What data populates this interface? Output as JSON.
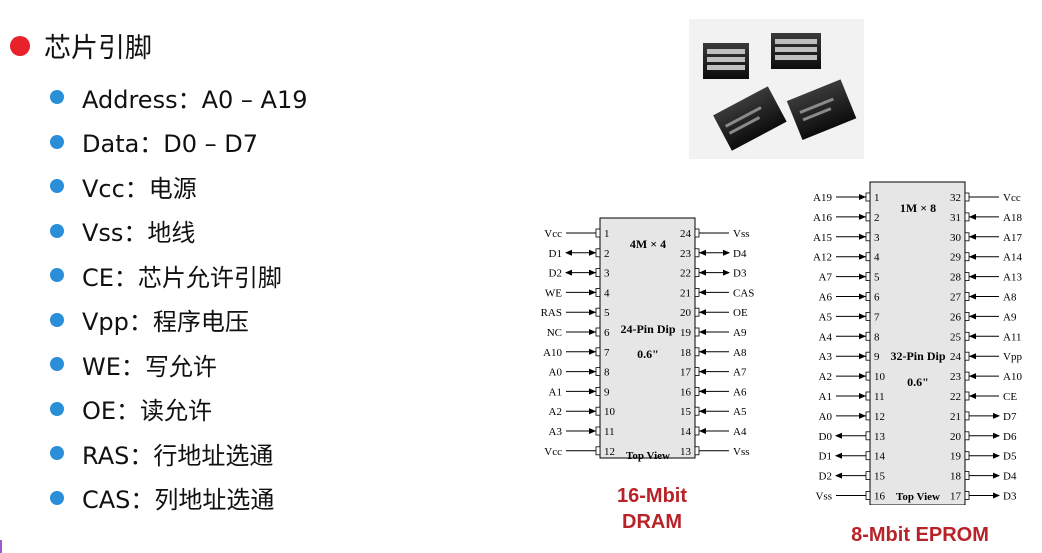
{
  "heading": {
    "title": "芯片引脚",
    "bullet_color": "#e8212b"
  },
  "pins_list": [
    "Address：A0 – A19",
    "Data：D0 – D7",
    "Vcc：电源",
    "Vss：地线",
    "CE：芯片允许引脚",
    "Vpp：程序电压",
    "WE：写允许",
    "OE：读允许",
    "RAS：行地址选通",
    "CAS：列地址选通"
  ],
  "dram": {
    "caption_line1": "16-Mbit",
    "caption_line2": "DRAM",
    "organization": "4M × 4",
    "package": "24-Pin Dip",
    "width": "0.6\"",
    "view": "Top View",
    "left_pins": [
      {
        "num": "1",
        "name": "Vcc",
        "dir": "none"
      },
      {
        "num": "2",
        "name": "D1",
        "dir": "both"
      },
      {
        "num": "3",
        "name": "D2",
        "dir": "both"
      },
      {
        "num": "4",
        "name": "WE",
        "dir": "in"
      },
      {
        "num": "5",
        "name": "RAS",
        "dir": "in"
      },
      {
        "num": "6",
        "name": "NC",
        "dir": "in"
      },
      {
        "num": "7",
        "name": "A10",
        "dir": "in"
      },
      {
        "num": "8",
        "name": "A0",
        "dir": "in"
      },
      {
        "num": "9",
        "name": "A1",
        "dir": "in"
      },
      {
        "num": "10",
        "name": "A2",
        "dir": "in"
      },
      {
        "num": "11",
        "name": "A3",
        "dir": "in"
      },
      {
        "num": "12",
        "name": "Vcc",
        "dir": "none"
      }
    ],
    "right_pins": [
      {
        "num": "24",
        "name": "Vss",
        "dir": "none"
      },
      {
        "num": "23",
        "name": "D4",
        "dir": "both"
      },
      {
        "num": "22",
        "name": "D3",
        "dir": "both"
      },
      {
        "num": "21",
        "name": "CAS",
        "dir": "in"
      },
      {
        "num": "20",
        "name": "OE",
        "dir": "in"
      },
      {
        "num": "19",
        "name": "A9",
        "dir": "in"
      },
      {
        "num": "18",
        "name": "A8",
        "dir": "in"
      },
      {
        "num": "17",
        "name": "A7",
        "dir": "in"
      },
      {
        "num": "16",
        "name": "A6",
        "dir": "in"
      },
      {
        "num": "15",
        "name": "A5",
        "dir": "in"
      },
      {
        "num": "14",
        "name": "A4",
        "dir": "in"
      },
      {
        "num": "13",
        "name": "Vss",
        "dir": "none"
      }
    ]
  },
  "eprom": {
    "caption": "8-Mbit EPROM",
    "organization": "1M × 8",
    "package": "32-Pin Dip",
    "width": "0.6\"",
    "view": "Top View",
    "left_pins": [
      {
        "num": "1",
        "name": "A19",
        "dir": "in"
      },
      {
        "num": "2",
        "name": "A16",
        "dir": "in"
      },
      {
        "num": "3",
        "name": "A15",
        "dir": "in"
      },
      {
        "num": "4",
        "name": "A12",
        "dir": "in"
      },
      {
        "num": "5",
        "name": "A7",
        "dir": "in"
      },
      {
        "num": "6",
        "name": "A6",
        "dir": "in"
      },
      {
        "num": "7",
        "name": "A5",
        "dir": "in"
      },
      {
        "num": "8",
        "name": "A4",
        "dir": "in"
      },
      {
        "num": "9",
        "name": "A3",
        "dir": "in"
      },
      {
        "num": "10",
        "name": "A2",
        "dir": "in"
      },
      {
        "num": "11",
        "name": "A1",
        "dir": "in"
      },
      {
        "num": "12",
        "name": "A0",
        "dir": "in"
      },
      {
        "num": "13",
        "name": "D0",
        "dir": "out"
      },
      {
        "num": "14",
        "name": "D1",
        "dir": "out"
      },
      {
        "num": "15",
        "name": "D2",
        "dir": "out"
      },
      {
        "num": "16",
        "name": "Vss",
        "dir": "none"
      }
    ],
    "right_pins": [
      {
        "num": "32",
        "name": "Vcc",
        "dir": "none"
      },
      {
        "num": "31",
        "name": "A18",
        "dir": "in"
      },
      {
        "num": "30",
        "name": "A17",
        "dir": "in"
      },
      {
        "num": "29",
        "name": "A14",
        "dir": "in"
      },
      {
        "num": "28",
        "name": "A13",
        "dir": "in"
      },
      {
        "num": "27",
        "name": "A8",
        "dir": "in"
      },
      {
        "num": "26",
        "name": "A9",
        "dir": "in"
      },
      {
        "num": "25",
        "name": "A11",
        "dir": "in"
      },
      {
        "num": "24",
        "name": "Vpp",
        "dir": "in"
      },
      {
        "num": "23",
        "name": "A10",
        "dir": "in"
      },
      {
        "num": "22",
        "name": "CE",
        "dir": "in"
      },
      {
        "num": "21",
        "name": "D7",
        "dir": "out"
      },
      {
        "num": "20",
        "name": "D6",
        "dir": "out"
      },
      {
        "num": "19",
        "name": "D5",
        "dir": "out"
      },
      {
        "num": "18",
        "name": "D4",
        "dir": "out"
      },
      {
        "num": "17",
        "name": "D3",
        "dir": "out"
      }
    ]
  },
  "caption_color": "#b8232a"
}
